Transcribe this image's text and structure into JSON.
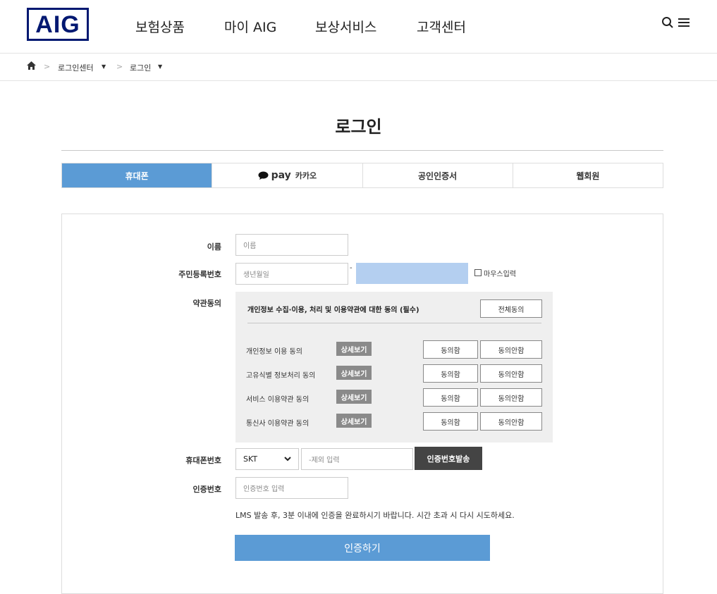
{
  "header": {
    "logo": "AIG",
    "nav": [
      "보험상품",
      "마이 AIG",
      "보상서비스",
      "고객센터"
    ],
    "search_icon": "search-icon",
    "menu_icon": "menu-icon"
  },
  "breadcrumb": {
    "home_icon": "home-icon",
    "items": [
      "로그인센터",
      "로그인"
    ]
  },
  "title": "로그인",
  "tabs": [
    {
      "label": "휴대폰",
      "active": true
    },
    {
      "label": "pay",
      "sub": "카카오"
    },
    {
      "label": "공인인증서"
    },
    {
      "label": "웹회원"
    }
  ],
  "form": {
    "name_label": "이름",
    "name_placeholder": "이름",
    "rrn_label": "주민등록번호",
    "rrn_placeholder": "생년월일",
    "rrn_sep": "-",
    "mouse_input": "마우스입력",
    "terms_label": "약관동의",
    "terms_title": "개인정보 수집·이용, 처리 및 이용약관에 대한 동의 (필수)",
    "agree_all": "전체동의",
    "terms": [
      {
        "label": "개인정보 이용 동의",
        "detail": "상세보기",
        "agree": "동의함",
        "disagree": "동의안함"
      },
      {
        "label": "고유식별 정보처리 동의",
        "detail": "상세보기",
        "agree": "동의함",
        "disagree": "동의안함"
      },
      {
        "label": "서비스 이용약관 동의",
        "detail": "상세보기",
        "agree": "동의함",
        "disagree": "동의안함"
      },
      {
        "label": "통신사 이용약관 동의",
        "detail": "상세보기",
        "agree": "동의함",
        "disagree": "동의안함"
      }
    ],
    "phone_label": "휴대폰번호",
    "carrier": "SKT",
    "phone_placeholder": "-제외 입력",
    "send_code": "인증번호발송",
    "code_label": "인증번호",
    "code_placeholder": "인증번호 입력",
    "notice": "LMS 발송 후, 3분 이내에 인증을 완료하시기 바랍니다. 시간 초과 시 다시 시도하세요.",
    "submit": "인증하기"
  },
  "colors": {
    "brand": "#001871",
    "accent": "#5b9bd5",
    "dark_button": "#444444",
    "rrn_focus": "#b4cff0"
  }
}
